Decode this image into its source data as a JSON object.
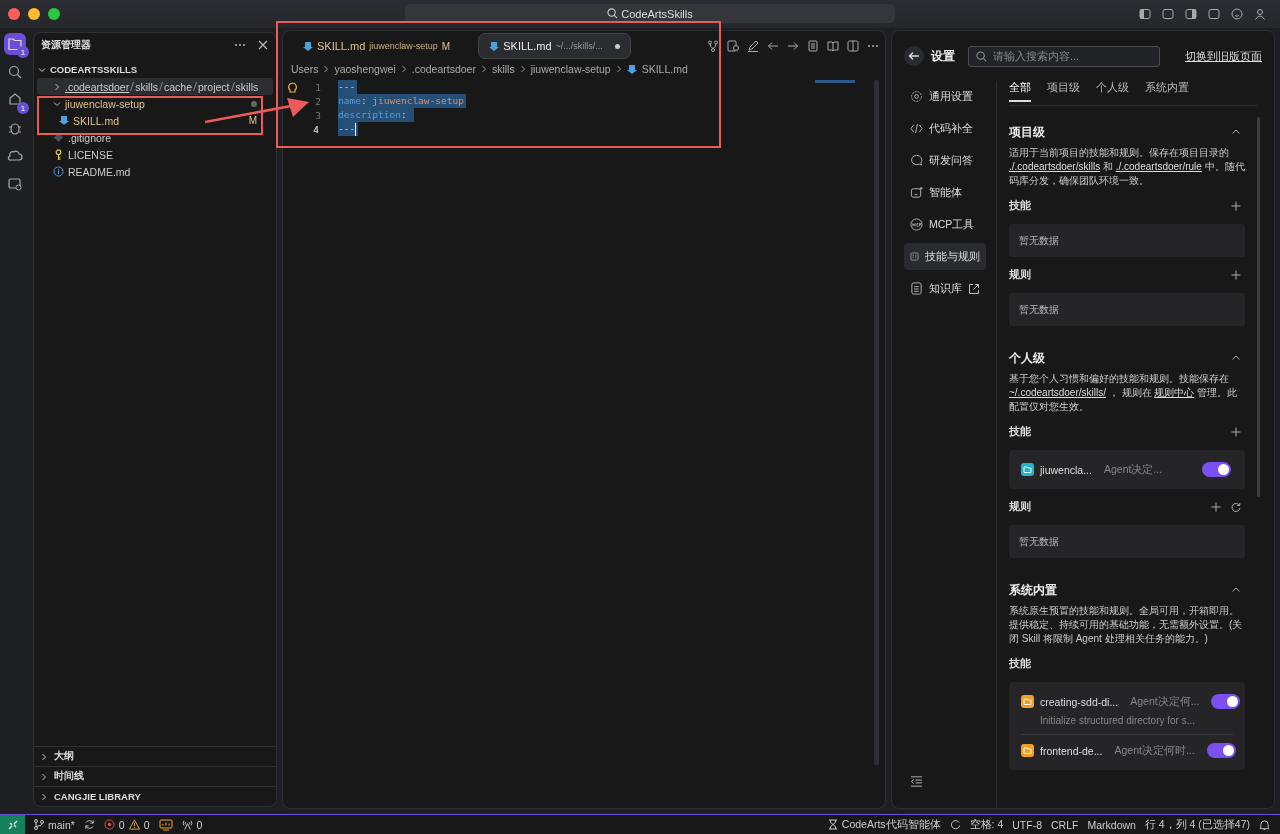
{
  "window": {
    "title": "CodeArtsSkills"
  },
  "activity_bar": [
    {
      "kind": "files",
      "selected": true,
      "badge": "1"
    },
    {
      "kind": "search",
      "selected": false
    },
    {
      "kind": "source-control",
      "selected": false,
      "badge": "1"
    },
    {
      "kind": "debug",
      "selected": false
    },
    {
      "kind": "extensions",
      "selected": false
    },
    {
      "kind": "remote",
      "selected": false
    }
  ],
  "explorer": {
    "title": "资源管理器",
    "root": "CODEARTSSKILLS",
    "tree": [
      {
        "kind": "compact-folder",
        "segments": [
          ".codeartsdoer",
          "skills",
          "cache",
          "project",
          "skills"
        ],
        "expanded": false,
        "selected": true,
        "modified": false
      },
      {
        "kind": "folder",
        "label": "jiuwenclaw-setup",
        "expanded": true,
        "selected": false,
        "modified": true,
        "children": [
          {
            "kind": "markdown",
            "label": "SKILL.md",
            "selected": false,
            "modified": true,
            "git_status": "M"
          }
        ]
      },
      {
        "kind": "gitignore",
        "label": ".gitignore",
        "selected": false,
        "modified": false
      },
      {
        "kind": "license",
        "label": "LICENSE",
        "selected": false,
        "modified": false
      },
      {
        "kind": "info",
        "label": "README.md",
        "selected": false,
        "modified": false
      }
    ],
    "sections": [
      {
        "label": "大纲",
        "expanded": false
      },
      {
        "label": "时间线",
        "expanded": false
      },
      {
        "label": "CANGJIE LIBRARY",
        "expanded": false
      }
    ]
  },
  "editor": {
    "tabs": [
      {
        "label": "SKILL.md",
        "description": "jiuwenclaw-setup",
        "badge": "M",
        "modified": true,
        "dirty": false,
        "selected": false
      },
      {
        "label": "SKILL.md",
        "description": "~/.../skills/...",
        "modified": false,
        "dirty": true,
        "selected": true
      }
    ],
    "breadcrumbs": [
      {
        "label": "Users",
        "kind": "folder"
      },
      {
        "label": "yaoshengwei",
        "kind": "folder"
      },
      {
        "label": ".codeartsdoer",
        "kind": "folder"
      },
      {
        "label": "skills",
        "kind": "folder"
      },
      {
        "label": "jiuwenclaw-setup",
        "kind": "folder"
      },
      {
        "label": "SKILL.md",
        "kind": "markdown"
      }
    ],
    "lines": [
      {
        "number": "1",
        "active": false,
        "selected": true,
        "segments": [
          {
            "text": "---",
            "kind": "punct"
          }
        ]
      },
      {
        "number": "2",
        "active": false,
        "selected": true,
        "segments": [
          {
            "text": "name",
            "kind": "key"
          },
          {
            "text": ": ",
            "kind": "punct"
          },
          {
            "text": "jiuwenclaw-setup",
            "kind": "value"
          }
        ]
      },
      {
        "number": "3",
        "active": false,
        "selected": true,
        "segments": [
          {
            "text": "description",
            "kind": "key"
          },
          {
            "text": ": ",
            "kind": "punct"
          }
        ]
      },
      {
        "number": "4",
        "active": true,
        "selected": true,
        "segments": [
          {
            "text": "---",
            "kind": "punct"
          }
        ]
      }
    ]
  },
  "settings": {
    "title": "设置",
    "search": {
      "placeholder": "请输入搜索内容..."
    },
    "switch_link": "切换到旧版页面",
    "nav": [
      {
        "label": "通用设置",
        "kind": "gear",
        "selected": false,
        "external": false
      },
      {
        "label": "代码补全",
        "kind": "code",
        "selected": false,
        "external": false
      },
      {
        "label": "研发问答",
        "kind": "chat",
        "selected": false,
        "external": false
      },
      {
        "label": "智能体",
        "kind": "agent",
        "selected": false,
        "external": false
      },
      {
        "label": "MCP工具",
        "kind": "mcp",
        "selected": false,
        "external": false
      },
      {
        "label": "技能与规则",
        "kind": "rules",
        "selected": true,
        "external": false
      },
      {
        "label": "知识库",
        "kind": "book",
        "selected": false,
        "external": true
      }
    ],
    "tabs": [
      {
        "label": "全部",
        "selected": true
      },
      {
        "label": "项目级",
        "selected": false
      },
      {
        "label": "个人级",
        "selected": false
      },
      {
        "label": "系统内置",
        "selected": false
      }
    ],
    "sections": [
      {
        "title": "项目级",
        "expanded": true,
        "description": [
          {
            "text": "适用于当前项目的技能和规则。保存在项目目录的 ",
            "kind": "text"
          },
          {
            "text": "./.codeartsdoer/skills",
            "kind": "link"
          },
          {
            "text": " 和 ",
            "kind": "text"
          },
          {
            "text": "./.codeartsdoer/rule",
            "kind": "link"
          },
          {
            "text": " 中。随代码库分发，确保团队环境一致。",
            "kind": "text"
          }
        ],
        "groups": [
          {
            "title": "技能",
            "can_add": true,
            "can_refresh": false,
            "empty_text": "暂无数据"
          },
          {
            "title": "规则",
            "can_add": true,
            "can_refresh": false,
            "empty_text": "暂无数据"
          }
        ]
      },
      {
        "title": "个人级",
        "expanded": true,
        "description": [
          {
            "text": "基于您个人习惯和偏好的技能和规则。技能保存在 ",
            "kind": "text"
          },
          {
            "text": "~/.codeartsdoer/skills/",
            "kind": "link"
          },
          {
            "text": " ，  规则在 ",
            "kind": "text"
          },
          {
            "text": "规则中心",
            "kind": "link"
          },
          {
            "text": " 管理。此配置仅对您生效。",
            "kind": "text"
          }
        ],
        "groups": [
          {
            "title": "技能",
            "can_add": true,
            "can_refresh": false,
            "items": [
              {
                "name": "jiuwencla...",
                "mode": "Agent决定...",
                "on": true,
                "color": "#1fb5c8"
              }
            ]
          },
          {
            "title": "规则",
            "can_add": true,
            "can_refresh": true,
            "empty_text": "暂无数据"
          }
        ]
      },
      {
        "title": "系统内置",
        "expanded": true,
        "description": [
          {
            "text": "系统原生预置的技能和规则。全局可用，开箱即用。提供稳定、持续可用的基础功能，无需额外设置。(关闭 Skill 将限制 Agent 处理相关任务的能力。)",
            "kind": "text"
          }
        ],
        "groups": [
          {
            "title": "技能",
            "can_add": false,
            "can_refresh": false,
            "items": [
              {
                "name": "creating-sdd-di...",
                "mode": "Agent决定何...",
                "description": "Initialize structured directory for s...",
                "on": true,
                "color": "#f5a024"
              },
              {
                "name": "frontend-de...",
                "mode": "Agent决定何时...",
                "on": true,
                "color": "#f5a024"
              }
            ]
          }
        ]
      }
    ]
  },
  "status_bar": {
    "branch": "main*",
    "errors": "0",
    "warnings": "0",
    "ports": "0",
    "right": [
      {
        "label": "CodeArts代码智能体",
        "kind": "agent"
      },
      {
        "label": "空格: 4",
        "kind": "text"
      },
      {
        "label": "UTF-8",
        "kind": "text"
      },
      {
        "label": "CRLF",
        "kind": "text"
      },
      {
        "label": "Markdown",
        "kind": "text"
      },
      {
        "label": "行 4，列 4 (已选择47)",
        "kind": "text"
      }
    ]
  }
}
